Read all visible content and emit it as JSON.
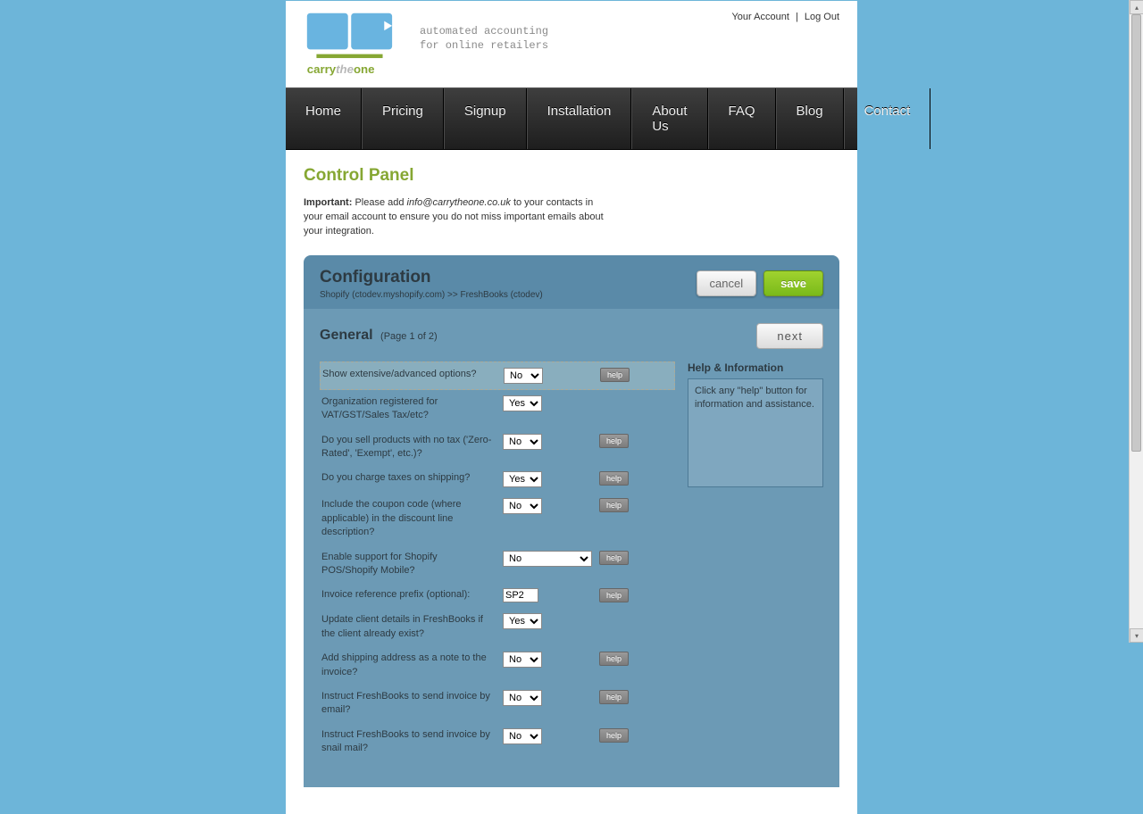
{
  "account": {
    "your_account": "Your Account",
    "logout": "Log Out"
  },
  "logo_text": {
    "l1": "carry",
    "l2": "the",
    "l3": "one"
  },
  "tagline": {
    "l1": "automated accounting",
    "l2": "for online retailers"
  },
  "nav": [
    "Home",
    "Pricing",
    "Signup",
    "Installation",
    "About Us",
    "FAQ",
    "Blog",
    "Contact"
  ],
  "cp_title": "Control Panel",
  "notice": {
    "strong": "Important:",
    "pre": " Please add ",
    "email": "info@carrytheone.co.uk",
    "post": " to your contacts in your email account to ensure you do not miss important emails about your integration."
  },
  "config": {
    "title": "Configuration",
    "breadcrumb": "Shopify (ctodev.myshopify.com) >> FreshBooks (ctodev)",
    "cancel": "cancel",
    "save": "save",
    "section": "General",
    "page_info": "(Page 1 of 2)",
    "next": "next"
  },
  "help_sidebar": {
    "title": "Help & Information",
    "text": "Click any \"help\" button for information and assistance."
  },
  "help_label": "help",
  "rows": [
    {
      "label": "Show extensive/advanced options?",
      "type": "select",
      "value": "No",
      "width": "sm",
      "help": true,
      "highlight": true
    },
    {
      "label": "Organization registered for VAT/GST/Sales Tax/etc?",
      "type": "select",
      "value": "Yes",
      "width": "sm",
      "help": false
    },
    {
      "label": "Do you sell products with no tax ('Zero-Rated', 'Exempt', etc.)?",
      "type": "select",
      "value": "No",
      "width": "sm",
      "help": true
    },
    {
      "label": "Do you charge taxes on shipping?",
      "type": "select",
      "value": "Yes",
      "width": "sm",
      "help": true
    },
    {
      "label": "Include the coupon code (where applicable) in the discount line description?",
      "type": "select",
      "value": "No",
      "width": "sm",
      "help": true
    },
    {
      "label": "Enable support for Shopify POS/Shopify Mobile?",
      "type": "select",
      "value": "No",
      "width": "lg",
      "help": true
    },
    {
      "label": "Invoice reference prefix (optional):",
      "type": "text",
      "value": "SP2",
      "help": true
    },
    {
      "label": "Update client details in FreshBooks if the client already exist?",
      "type": "select",
      "value": "Yes",
      "width": "sm",
      "help": false
    },
    {
      "label": "Add shipping address as a note to the invoice?",
      "type": "select",
      "value": "No",
      "width": "sm",
      "help": true
    },
    {
      "label": "Instruct FreshBooks to send invoice by email?",
      "type": "select",
      "value": "No",
      "width": "sm",
      "help": true
    },
    {
      "label": "Instruct FreshBooks to send invoice by snail mail?",
      "type": "select",
      "value": "No",
      "width": "sm",
      "help": true
    }
  ]
}
